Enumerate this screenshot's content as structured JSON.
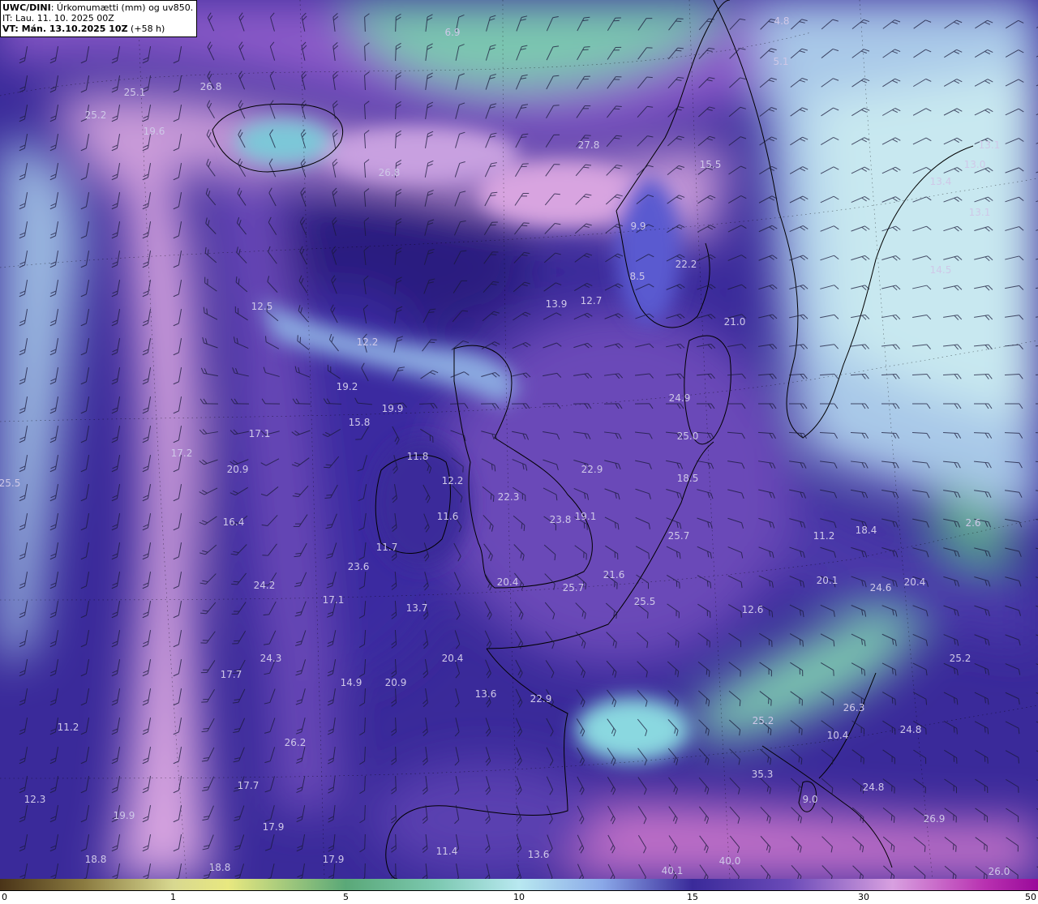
{
  "header": {
    "model": "UWC/DINI",
    "title_rest": ": Úrkomumætti (mm) og uv850.",
    "it_line": "IT: Lau. 11. 10. 2025 00Z",
    "vt_line": "VT: Mán. 13.10.2025 10Z",
    "lead": " (+58 h)"
  },
  "colorbar": {
    "ticks": [
      "0",
      "1",
      "5",
      "10",
      "15",
      "30",
      "50"
    ]
  },
  "colors": {
    "deep_purple": "#2e1f86",
    "violet": "#6a4ab8",
    "light_pink": "#cfa0dc",
    "cyan_light": "#a8d8e8",
    "teal": "#5aa88a",
    "coast": "#000000",
    "barb": "#1a1a3a",
    "value_text": "#cfc8e8"
  },
  "map_values": [
    {
      "v": "6.9"
    },
    {
      "v": "4.8"
    },
    {
      "v": "5.1"
    },
    {
      "v": "25.1"
    },
    {
      "v": "26.8"
    },
    {
      "v": "25.2"
    },
    {
      "v": "19.6"
    },
    {
      "v": "26.8"
    },
    {
      "v": "27.8"
    },
    {
      "v": "13.1"
    },
    {
      "v": "13.0"
    },
    {
      "v": "13.4"
    },
    {
      "v": "13.1"
    },
    {
      "v": "15.5"
    },
    {
      "v": "22.2"
    },
    {
      "v": "12.5"
    },
    {
      "v": "13.9"
    },
    {
      "v": "12.7"
    },
    {
      "v": "21.0"
    },
    {
      "v": "12.2"
    },
    {
      "v": "19.2"
    },
    {
      "v": "19.9"
    },
    {
      "v": "15.8"
    },
    {
      "v": "24.9"
    },
    {
      "v": "17.1"
    },
    {
      "v": "25.0"
    },
    {
      "v": "17.2"
    },
    {
      "v": "11.8"
    },
    {
      "v": "20.9"
    },
    {
      "v": "22.9"
    },
    {
      "v": "12.2"
    },
    {
      "v": "18.5"
    },
    {
      "v": "22.3"
    },
    {
      "v": "25.5"
    },
    {
      "v": "11.6"
    },
    {
      "v": "23.8"
    },
    {
      "v": "19.1"
    },
    {
      "v": "16.4"
    },
    {
      "v": "25.7"
    },
    {
      "v": "11.2"
    },
    {
      "v": "18.4"
    },
    {
      "v": "11.7"
    },
    {
      "v": "23.6"
    },
    {
      "v": "21.6"
    },
    {
      "v": "20.1"
    },
    {
      "v": "24.6"
    },
    {
      "v": "25.7"
    },
    {
      "v": "20.4"
    },
    {
      "v": "20.4"
    },
    {
      "v": "24.2"
    },
    {
      "v": "17.1"
    },
    {
      "v": "13.7"
    },
    {
      "v": "25.5"
    },
    {
      "v": "12.6"
    },
    {
      "v": "24.3"
    },
    {
      "v": "20.4"
    },
    {
      "v": "25.2"
    },
    {
      "v": "17.7"
    },
    {
      "v": "14.9"
    },
    {
      "v": "20.9"
    },
    {
      "v": "13.6"
    },
    {
      "v": "22.9"
    },
    {
      "v": "26.3"
    },
    {
      "v": "11.2"
    },
    {
      "v": "25.2"
    },
    {
      "v": "24.8"
    },
    {
      "v": "26.2"
    },
    {
      "v": "10.4"
    },
    {
      "v": "35.3"
    },
    {
      "v": "17.7"
    },
    {
      "v": "24.8"
    },
    {
      "v": "12.3"
    },
    {
      "v": "19.9"
    },
    {
      "v": "17.9"
    },
    {
      "v": "9.0"
    },
    {
      "v": "26.9"
    },
    {
      "v": "11.4"
    },
    {
      "v": "13.6"
    },
    {
      "v": "18.8"
    },
    {
      "v": "18.8"
    },
    {
      "v": "17.9"
    },
    {
      "v": "40.0"
    },
    {
      "v": "40.1"
    },
    {
      "v": "26.0"
    },
    {
      "v": "14.5"
    },
    {
      "v": "8.5"
    },
    {
      "v": "9.9"
    },
    {
      "v": "2.6"
    }
  ]
}
